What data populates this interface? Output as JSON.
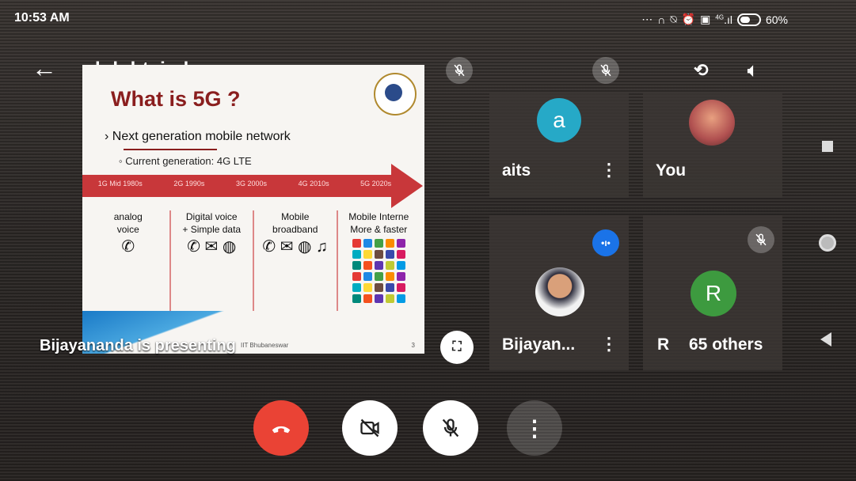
{
  "status_bar": {
    "time": "10:53 AM",
    "icons": [
      "more-icon",
      "headset-icon",
      "mute-notification-icon",
      "alarm-icon",
      "media-icon",
      "signal-icon",
      "battery-icon"
    ],
    "signal_label": "4G",
    "battery": "60%"
  },
  "meeting": {
    "code": "dnk-btxj-ybr"
  },
  "presentation": {
    "presenter_label": "Bijayananda is presenting",
    "slide": {
      "title": "What is 5G ?",
      "bullet1": "Next generation mobile network",
      "bullet2": "Current generation: 4G LTE",
      "generations": [
        "1G Mid 1980s",
        "2G 1990s",
        "3G 2000s",
        "4G 2010s",
        "5G 2020s"
      ],
      "columns": [
        {
          "line1": "analog",
          "line2": "voice",
          "icons": "✆"
        },
        {
          "line1": "Digital voice",
          "line2": "+ Simple data",
          "icons": "✆ ✉ ◍"
        },
        {
          "line1": "Mobile",
          "line2": "broadband",
          "icons": "✆ ✉ ◍ ♫"
        },
        {
          "line1": "Mobile Interne",
          "line2": "More & faster",
          "icons": ""
        }
      ],
      "org": "IIT Bhubaneswar",
      "page": "3",
      "app_colors": [
        "#e53935",
        "#1e88e5",
        "#43a047",
        "#fb8c00",
        "#8e24aa",
        "#00acc1",
        "#fdd835",
        "#6d4c41",
        "#3949ab",
        "#d81b60",
        "#00897b",
        "#f4511e",
        "#5e35b1",
        "#c0ca33",
        "#039be5",
        "#e53935",
        "#1e88e5",
        "#43a047",
        "#fb8c00",
        "#8e24aa",
        "#00acc1",
        "#fdd835",
        "#6d4c41",
        "#3949ab",
        "#d81b60",
        "#00897b",
        "#f4511e",
        "#5e35b1",
        "#c0ca33",
        "#039be5"
      ]
    }
  },
  "participants": [
    {
      "name": "aits",
      "initial": "a",
      "avatar_color": "#26a9c7",
      "muted": true
    },
    {
      "name": "You",
      "initial": "",
      "avatar_color": "#b05050",
      "muted": true
    },
    {
      "name": "Bijayan...",
      "initial": "",
      "avatar_color": "#f2f2f2",
      "speaking": true
    },
    {
      "name": "R",
      "initial": "R",
      "avatar_color": "#3d9a3f",
      "muted": true,
      "others_label": "65 others"
    }
  ],
  "controls": {
    "end_call": "end-call",
    "camera": "camera-off",
    "mic": "mic-off",
    "more": "more-options"
  }
}
